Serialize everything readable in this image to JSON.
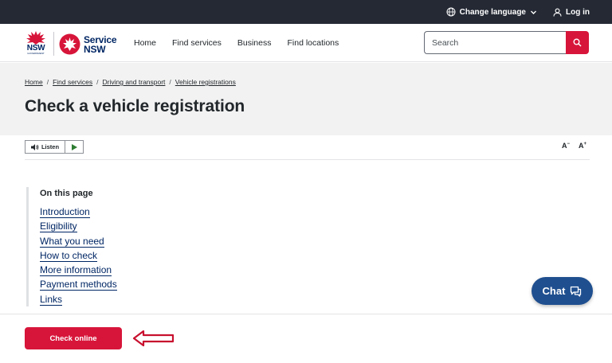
{
  "topbar": {
    "language_label": "Change language",
    "login_label": "Log in",
    "icons": [
      "globe-icon",
      "chevron-down-icon",
      "user-icon"
    ]
  },
  "header": {
    "logo_nsw": "NSW",
    "logo_government": "GOVERNMENT",
    "logo_service_line1": "Service",
    "logo_service_line2": "NSW",
    "nav": [
      "Home",
      "Find services",
      "Business",
      "Find locations"
    ],
    "search_placeholder": "Search",
    "colors": {
      "brand_red": "#d7153a",
      "brand_navy": "#002664"
    }
  },
  "breadcrumb": [
    "Home",
    "Find services",
    "Driving and transport",
    "Vehicle registrations"
  ],
  "page": {
    "title": "Check a vehicle registration"
  },
  "listen": {
    "label": "Listen",
    "font_decrease": "A",
    "font_decrease_sup": "−",
    "font_increase": "A",
    "font_increase_sup": "+"
  },
  "on_this_page": {
    "title": "On this page",
    "links": [
      "Introduction",
      "Eligibility",
      "What you need",
      "How to check",
      "More information",
      "Payment methods",
      "Links"
    ]
  },
  "chat": {
    "label": "Chat"
  },
  "cta": {
    "label": "Check online"
  }
}
